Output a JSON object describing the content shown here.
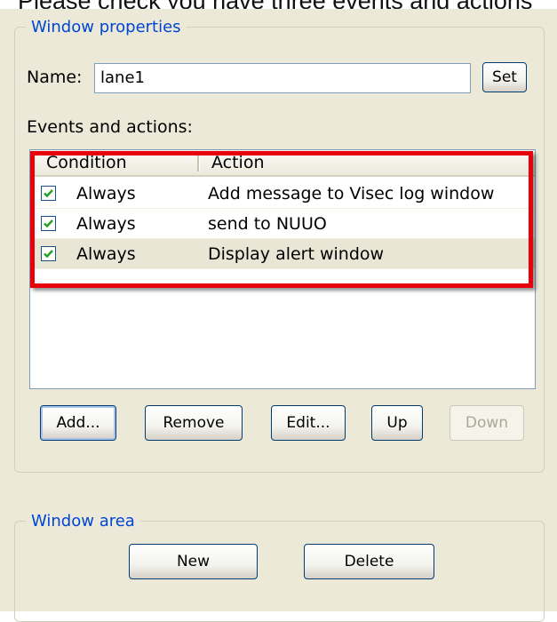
{
  "caption": "Please check you have three events and actions",
  "window_properties": {
    "legend": "Window properties",
    "name_label": "Name:",
    "name_value": "lane1",
    "set_button": "Set",
    "events_label": "Events and actions:",
    "columns": [
      "Condition",
      "Action"
    ],
    "rows": [
      {
        "checked": true,
        "condition": "Always",
        "action": "Add message to Visec log window"
      },
      {
        "checked": true,
        "condition": "Always",
        "action": "send to NUUO"
      },
      {
        "checked": true,
        "condition": "Always",
        "action": "Display alert window"
      }
    ],
    "buttons": {
      "add": "Add...",
      "remove": "Remove",
      "edit": "Edit...",
      "up": "Up",
      "down": "Down"
    }
  },
  "window_area": {
    "legend": "Window area",
    "new_button": "New",
    "delete_button": "Delete"
  },
  "colors": {
    "group_legend": "#0046d5",
    "highlight_border": "#e8000b",
    "checkmark": "#21a121",
    "panel_bg": "#ece9d8"
  }
}
